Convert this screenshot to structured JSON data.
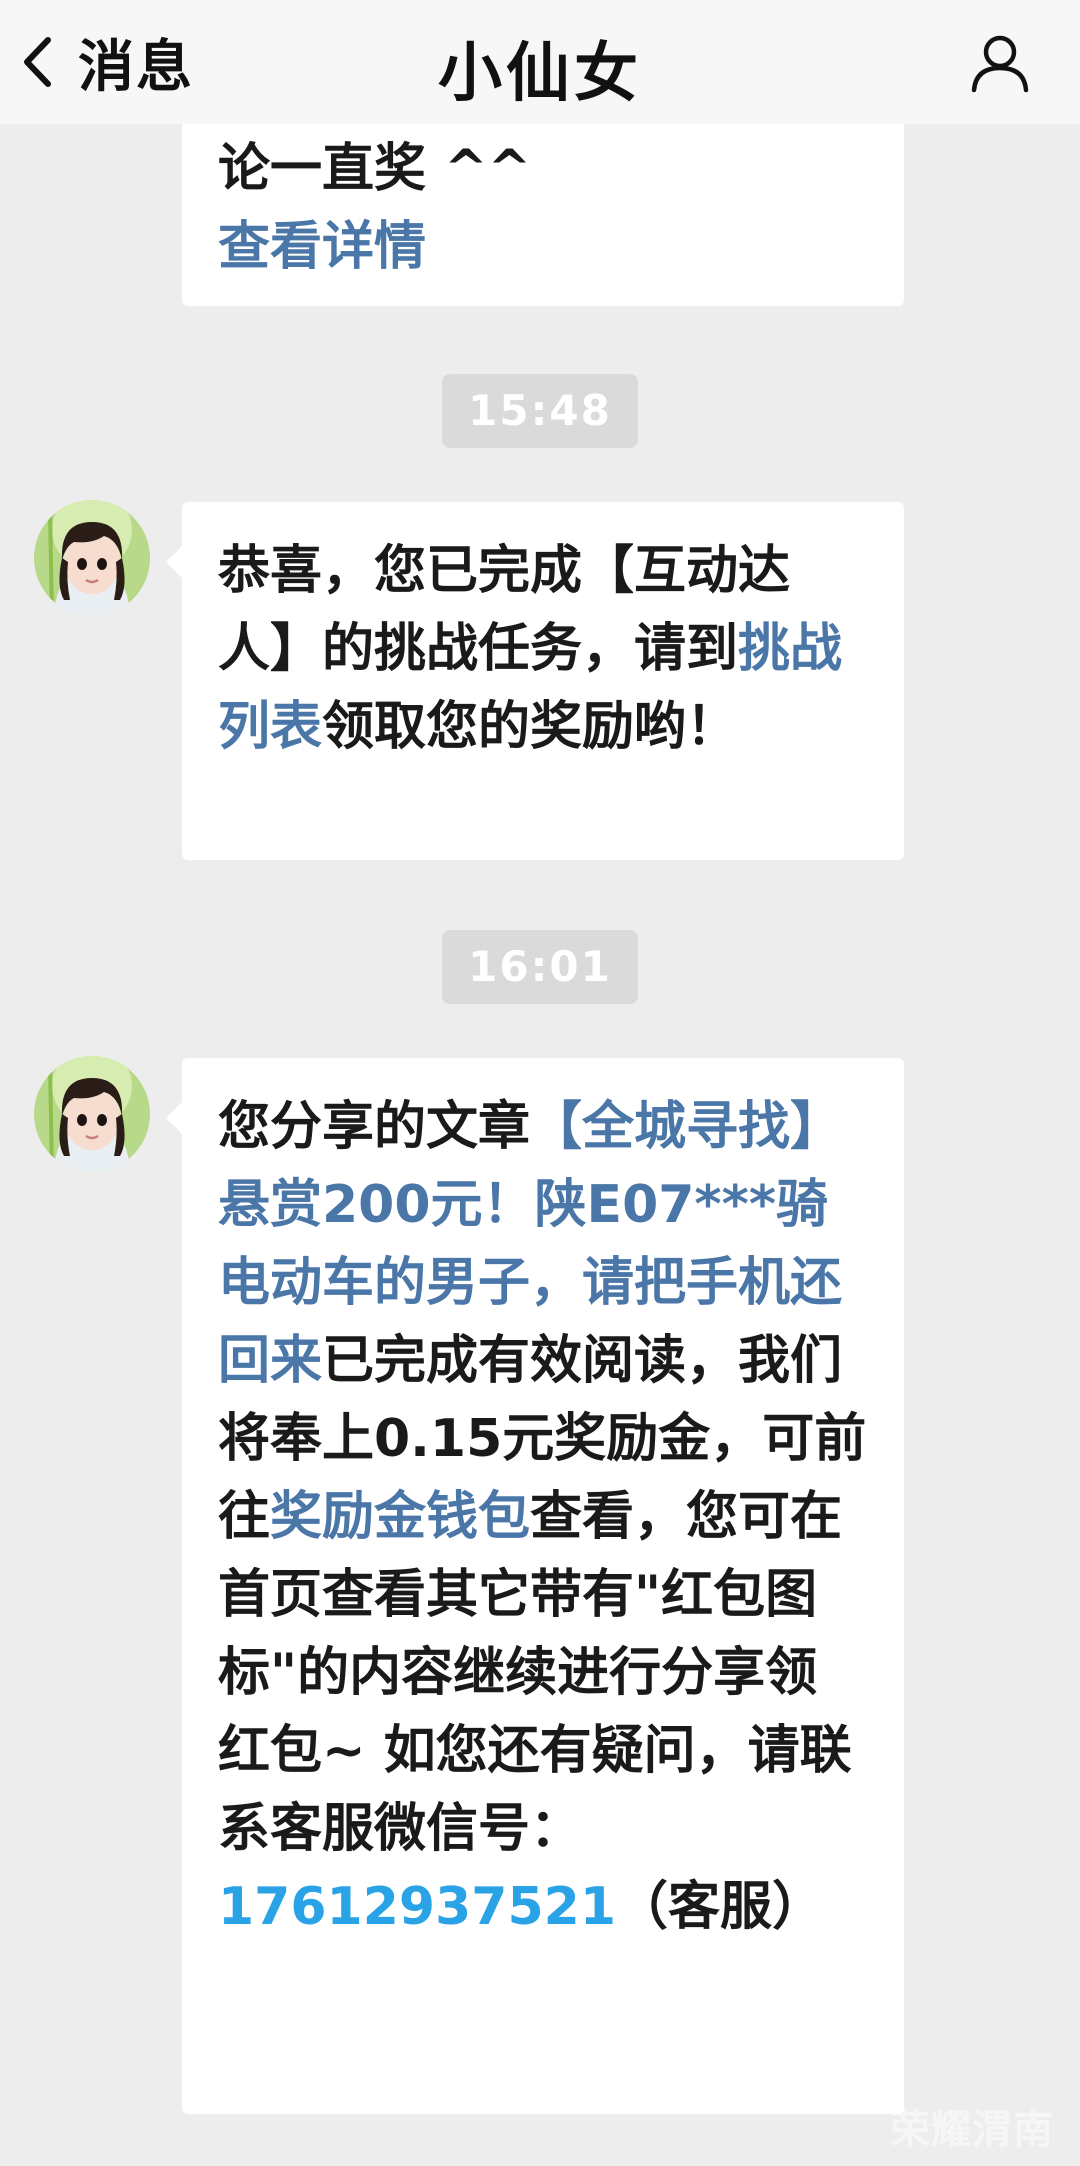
{
  "header": {
    "back_label": "消息",
    "title": "小仙女"
  },
  "messages": {
    "m0": {
      "line1": "论一直奖 ^^",
      "link": "查看详情"
    },
    "t1": "15:48",
    "m1": {
      "pre": "恭喜，您已完成【互动达人】的挑战任务，请到",
      "link": "挑战列表",
      "post": "领取您的奖励哟！"
    },
    "t2": "16:01",
    "m2": {
      "pre": "您分享的文章",
      "article_link": "【全城寻找】悬赏200元！陕E07***骑电动车的男子，请把手机还回来",
      "mid": "已完成有效阅读，我们将奉上0.15元奖励金，可前往",
      "wallet_link": "奖励金钱包",
      "post": "查看，您可在首页查看其它带有\"红包图标\"的内容继续进行分享领红包~ 如您还有疑问，请联系客服微信号：",
      "phone": "17612937521",
      "suffix": "（客服）"
    }
  },
  "watermark": "荣耀渭南",
  "colors": {
    "link": "#4a76a8",
    "phone": "#2aa3e6",
    "background": "#ededed",
    "bubble": "#ffffff",
    "time_chip": "#dadada"
  },
  "icons": {
    "back": "chevron-left-icon",
    "profile": "person-icon",
    "avatar": "girl-avatar-image"
  }
}
